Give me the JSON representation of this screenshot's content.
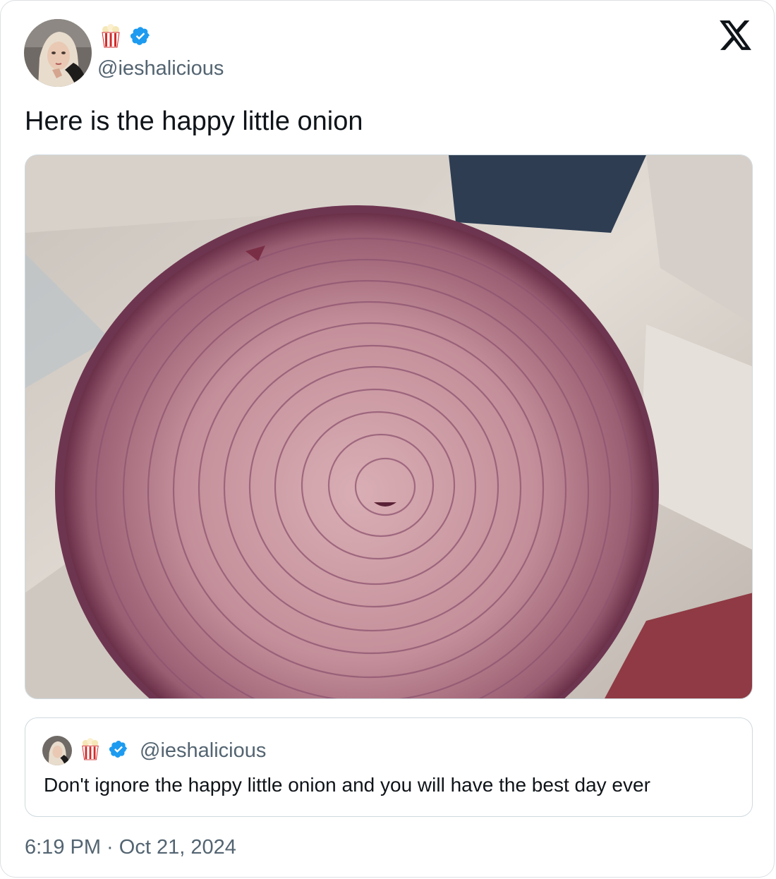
{
  "author": {
    "handle": "@ieshalicious",
    "name_emoji_icon": "popcorn-icon",
    "verified_icon": "verified-badge-icon"
  },
  "brand_icon": "x-logo-icon",
  "tweet": {
    "text": "Here is the happy little onion",
    "media_description_icon": "red-onion-photo"
  },
  "quoted_tweet": {
    "handle": "@ieshalicious",
    "text": "Don't ignore the happy little onion and you will have the best day ever"
  },
  "timestamp": "6:19 PM · Oct 21, 2024",
  "colors": {
    "verified": "#1d9bf0",
    "secondary_text": "#536471",
    "border": "#cfd9de"
  }
}
